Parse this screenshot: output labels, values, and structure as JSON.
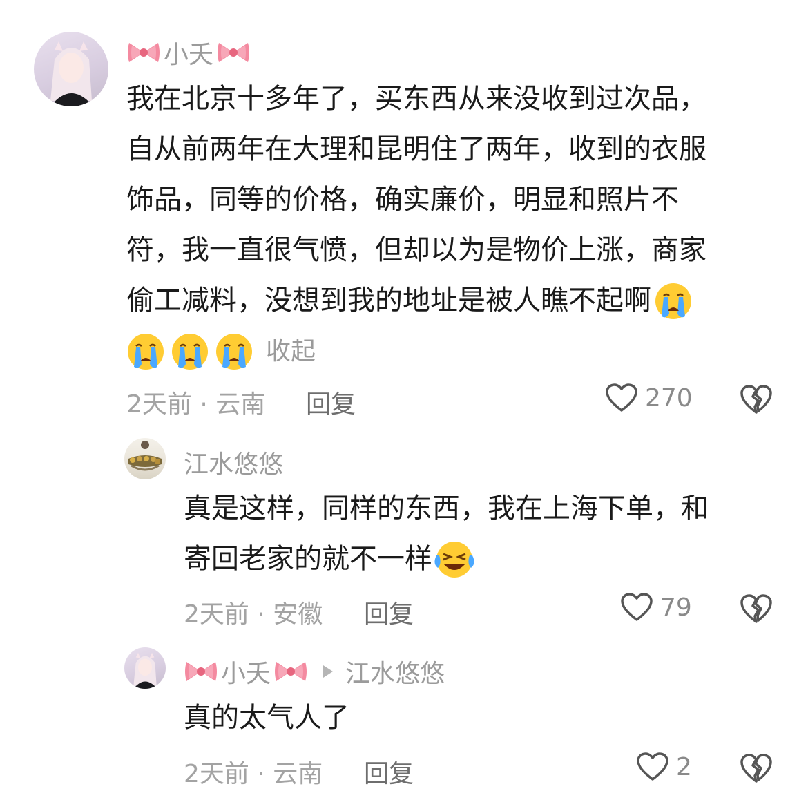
{
  "comments": [
    {
      "author": "小夭",
      "lines": [
        "我在北京十多年了，买东西从来没收到过次品，",
        "自从前两年在大理和昆明住了两年，收到的衣服",
        "饰品，同等的价格，确实廉价，明显和照片不",
        "符，我一直很气愤，但却以为是物价上涨，商家",
        "偷工减料，没想到我的地址是被人瞧不起啊"
      ],
      "collapse_label": "收起",
      "time": "2天前",
      "location": "云南",
      "reply_label": "回复",
      "likes": "270",
      "icons": [
        "bow-icon",
        "crying-face-icon",
        "heart-icon",
        "broken-heart-icon"
      ]
    },
    {
      "author": "江水悠悠",
      "lines": [
        "真是这样，同样的东西，我在上海下单，和",
        "寄回老家的就不一样"
      ],
      "time": "2天前",
      "location": "安徽",
      "reply_label": "回复",
      "likes": "79"
    },
    {
      "author": "小夭",
      "reply_to": "江水悠悠",
      "lines": [
        "真的太气人了"
      ],
      "time": "2天前",
      "location": "云南",
      "reply_label": "回复",
      "likes": "2"
    }
  ],
  "meta_separator": "·",
  "colors": {
    "text": "#1a1a1a",
    "muted": "#9b9b9b",
    "bow": "#f2849a",
    "emoji": "#ffcc33",
    "tear": "#4aa8ff"
  }
}
